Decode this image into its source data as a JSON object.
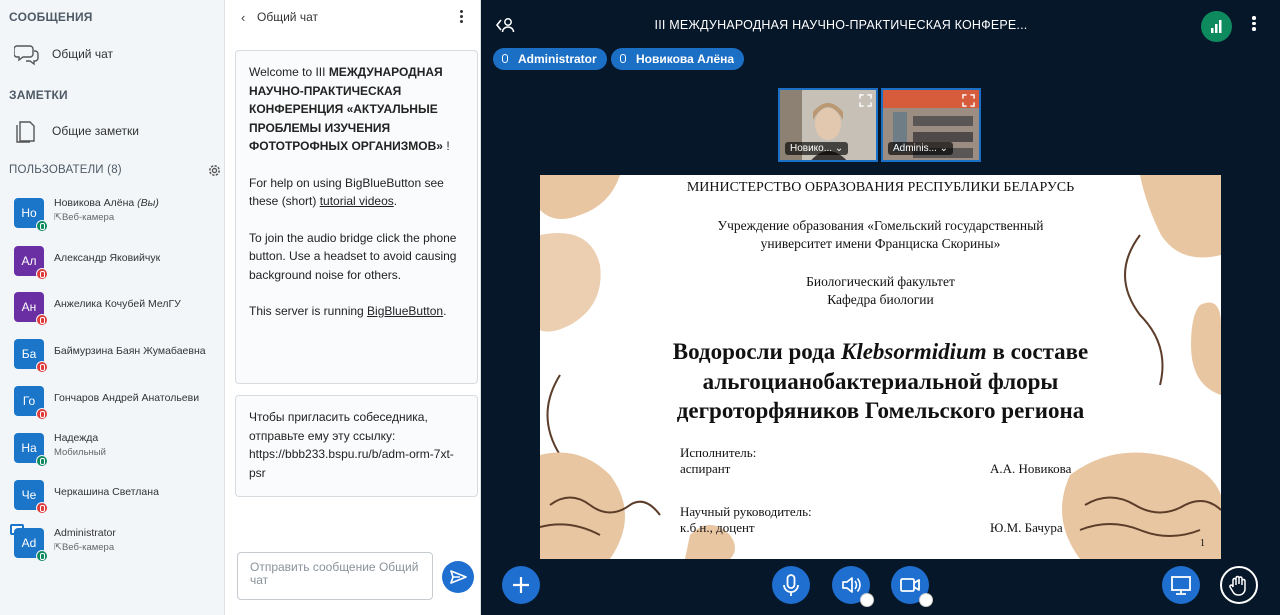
{
  "sidebar": {
    "messages_title": "СООБЩЕНИЯ",
    "public_chat_label": "Общий чат",
    "notes_title": "ЗАМЕТКИ",
    "shared_notes_label": "Общие заметки",
    "users_title": "ПОЛЬЗОВАТЕЛИ (8)",
    "users": [
      {
        "initials": "Но",
        "name": "Новикова Алёна",
        "you": "(Вы)",
        "sub": "Веб-камера",
        "color": "#1b75c8",
        "badge": "green"
      },
      {
        "initials": "Ал",
        "name": "Александр Яковийчук",
        "sub": "",
        "color": "#6a2fa3",
        "badge": "red"
      },
      {
        "initials": "Ан",
        "name": "Анжелика Кочубей МелГУ",
        "sub": "",
        "color": "#6a2fa3",
        "badge": "red"
      },
      {
        "initials": "Ба",
        "name": "Баймурзина Баян Жумабаевна",
        "sub": "",
        "color": "#1b75c8",
        "badge": "red"
      },
      {
        "initials": "Го",
        "name": "Гончаров Андрей Анатольеви",
        "sub": "",
        "color": "#1b75c8",
        "badge": "red"
      },
      {
        "initials": "На",
        "name": "Надежда",
        "sub": "Мобильный",
        "color": "#1b75c8",
        "badge": "green"
      },
      {
        "initials": "Че",
        "name": "Черкашина Светлана",
        "sub": "",
        "color": "#1b75c8",
        "badge": "red"
      },
      {
        "initials": "Ad",
        "name": "Administrator",
        "sub": "Веб-камера",
        "color": "#1b75c8",
        "badge": "green"
      }
    ]
  },
  "chat": {
    "title": "Общий чат",
    "welcome": {
      "prefix": "Welcome to III ",
      "bold": "МЕЖДУНАРОДНАЯ НАУЧНО-ПРАКТИЧЕСКАЯ КОНФЕРЕНЦИЯ «АКТУАЛЬНЫЕ ПРОБЛЕМЫ ИЗУЧЕНИЯ ФОТОТРОФНЫХ ОРГАНИЗМОВ»",
      "suffix": " !",
      "help_prefix": "For help on using BigBlueButton see these (short) ",
      "help_link": "tutorial videos",
      "help_suffix": ".",
      "audio": "To join the audio bridge click the phone button. Use a headset to avoid causing background noise for others.",
      "server_prefix": "This server is running ",
      "server_link": "BigBlueButton",
      "server_suffix": "."
    },
    "invite": {
      "text": "Чтобы пригласить собеседника, отправьте ему эту ссылку:",
      "url": "https://bbb233.bspu.ru/b/adm-orm-7xt-psr"
    },
    "input_placeholder": "Отправить сообщение Общий чат"
  },
  "main": {
    "title": "III МЕЖДУНАРОДНАЯ НАУЧНО-ПРАКТИЧЕСКАЯ КОНФЕРЕ...",
    "talkers": [
      "Administrator",
      "Новикова Алёна"
    ],
    "videos": [
      "Новико...",
      "Adminis..."
    ],
    "slide": {
      "ministry": "МИНИСТЕРСТВО ОБРАЗОВАНИЯ РЕСПУБЛИКИ БЕЛАРУСЬ",
      "university_1": "Учреждение образования «Гомельский государственный",
      "university_2": "университет имени Франциска Скорины»",
      "faculty": "Биологический факультет",
      "department": "Кафедра биологии",
      "title_1a": "Водоросли рода ",
      "title_1b": "Klebsormidium",
      "title_1c": " в составе",
      "title_2": "альгоцианобактериальной флоры",
      "title_3": "дегроторфяников Гомельского региона",
      "performer_label": "Исполнитель:",
      "performer_role": "аспирант",
      "performer_name": "А.А. Новикова",
      "supervisor_label": "Научный руководитель:",
      "supervisor_role": "к.б.н., доцент",
      "supervisor_name": "Ю.М. Бачура",
      "page": "1"
    }
  },
  "colors": {
    "accent": "#1f6fd0",
    "dark_bg": "#06172a",
    "connection": "#0e8a5f",
    "blob_tan": "#e9c6a2",
    "blob_dark": "#5c3d2a"
  }
}
